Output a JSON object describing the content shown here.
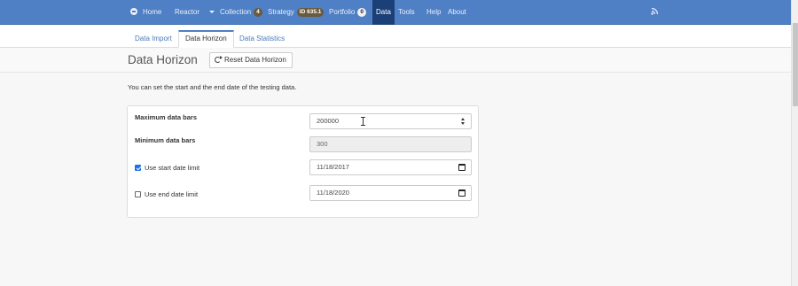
{
  "navbar": {
    "items": [
      {
        "label": "Home",
        "icon": "home-icon"
      },
      {
        "label": "Reactor",
        "icon": "caret-down-icon"
      },
      {
        "label": "Collection",
        "badge": "4"
      },
      {
        "label": "Strategy",
        "badge": "ID 635.1"
      },
      {
        "label": "Portfolio",
        "badge": "0"
      },
      {
        "label": "Data",
        "active": true
      },
      {
        "label": "Tools"
      },
      {
        "label": "Help"
      },
      {
        "label": "About"
      }
    ],
    "right_icon": "rss-feed-icon",
    "color": "#4f7fc4",
    "active_color": "#1b3f77"
  },
  "tabs": [
    {
      "label": "Data Import"
    },
    {
      "label": "Data Horizon",
      "active": true
    },
    {
      "label": "Data Statistics"
    }
  ],
  "header": {
    "title": "Data Horizon",
    "reset_button": "Reset Data Horizon",
    "reset_icon": "refresh-icon"
  },
  "description": "You can set the start and the end date of the testing data.",
  "form": {
    "max_bars": {
      "label": "Maximum data bars",
      "value": "200000"
    },
    "min_bars": {
      "label": "Minimum data bars",
      "value": "300"
    },
    "start_date": {
      "label": "Use start date limit",
      "checked": true,
      "value": "11/18/2017"
    },
    "end_date": {
      "label": "Use end date limit",
      "checked": false,
      "value": "11/18/2020"
    }
  }
}
